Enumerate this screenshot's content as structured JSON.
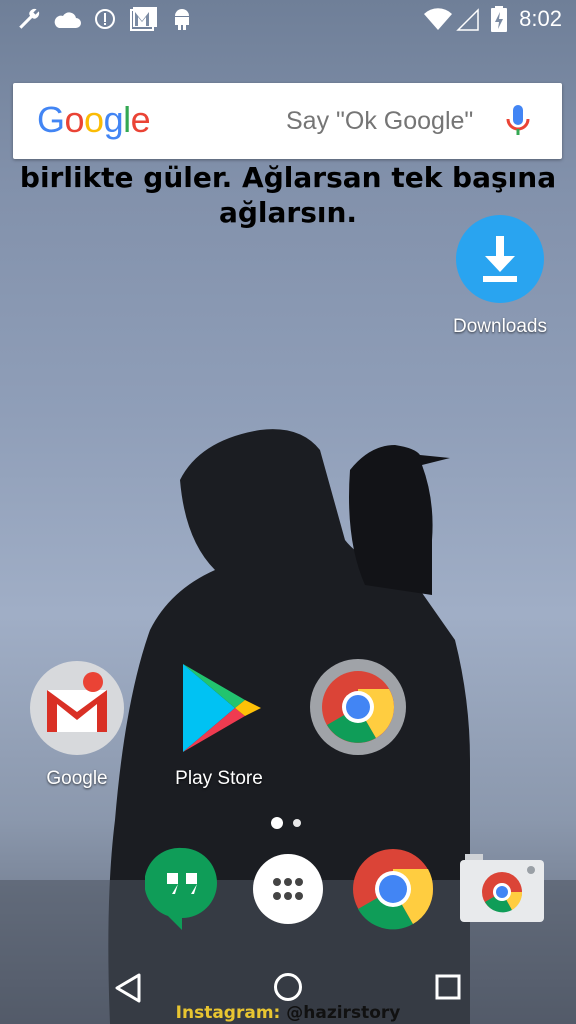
{
  "status_bar": {
    "time": "8:02",
    "left_icons": [
      "wrench-icon",
      "cloud-icon",
      "info-circle-icon",
      "gallery-mail-icon",
      "android-icon"
    ],
    "right_icons": [
      "wifi-icon",
      "cell-signal-icon",
      "battery-charging-icon"
    ]
  },
  "search_widget": {
    "logo": [
      "G",
      "o",
      "o",
      "g",
      "l",
      "e"
    ],
    "logo_colors": [
      "#4285F4",
      "#EA4335",
      "#FBBC05",
      "#4285F4",
      "#34A853",
      "#EA4335"
    ],
    "hint": "Say \"Ok Google\""
  },
  "wallpaper_text": {
    "line1": "birlikte güler. Ağlarsan tek başına",
    "line2": "ağlarsın."
  },
  "desktop_apps": [
    {
      "label": "Downloads",
      "icon": "download-icon",
      "color": "#29a4f0"
    },
    {
      "label": "Google",
      "icon": "gmail-icon"
    },
    {
      "label": "Play Store",
      "icon": "play-store-icon"
    },
    {
      "label": "",
      "icon": "chrome-icon"
    }
  ],
  "page_indicator": {
    "pages": 2,
    "current": 1
  },
  "dock": [
    {
      "icon": "hangouts-icon",
      "color": "#0f9d58"
    },
    {
      "icon": "app-drawer-icon",
      "color": "#ffffff"
    },
    {
      "icon": "chrome-icon"
    },
    {
      "icon": "camera-icon"
    }
  ],
  "nav_bar": [
    "back-icon",
    "home-icon",
    "recents-icon"
  ],
  "watermark": {
    "label": "Instagram:",
    "handle": "@hazirstory"
  },
  "colors": {
    "google_blue": "#4285F4",
    "google_red": "#EA4335",
    "google_yellow": "#FBBC05",
    "google_green": "#34A853"
  }
}
